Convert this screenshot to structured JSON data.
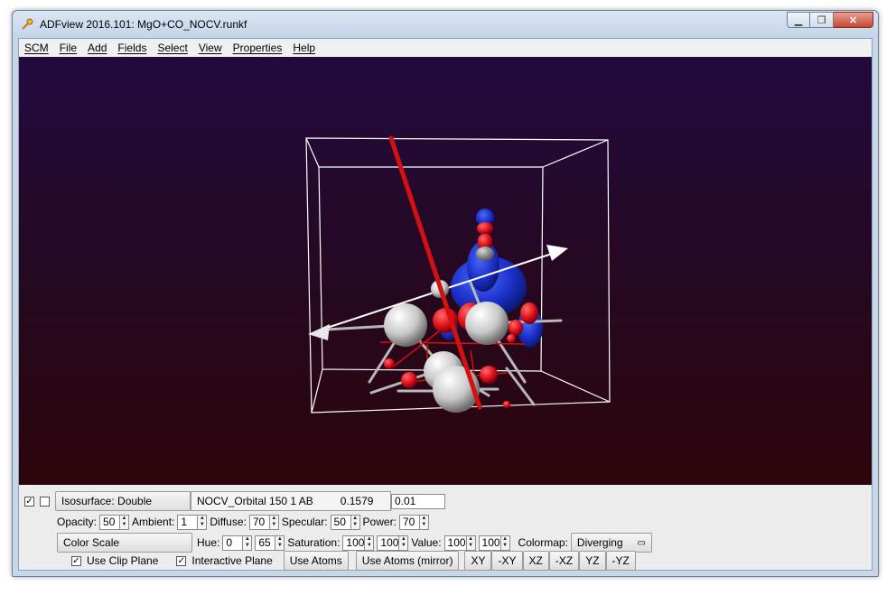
{
  "window": {
    "title": "ADFview 2016.101: MgO+CO_NOCV.runkf"
  },
  "menu": [
    "SCM",
    "File",
    "Add",
    "Fields",
    "Select",
    "View",
    "Properties",
    "Help"
  ],
  "isosurface": {
    "enabled_check": "✓",
    "type_label": "Isosurface: Double",
    "field_name": "NOCV_Orbital 150 1 AB",
    "field_value": "0.1579",
    "iso_value": "0.01"
  },
  "lighting": {
    "opacity_label": "Opacity:",
    "opacity": "50",
    "ambient_label": "Ambient:",
    "ambient": "1",
    "diffuse_label": "Diffuse:",
    "diffuse": "70",
    "specular_label": "Specular:",
    "specular": "50",
    "power_label": "Power:",
    "power": "70"
  },
  "color": {
    "scale_button": "Color Scale",
    "hue_label": "Hue:",
    "hue_min": "0",
    "hue_max": "65",
    "saturation_label": "Saturation:",
    "sat_min": "100",
    "sat_max": "100",
    "value_label": "Value:",
    "val_min": "100",
    "val_max": "100",
    "colormap_label": "Colormap:",
    "colormap": "Diverging"
  },
  "clip": {
    "use_clip_plane": "Use Clip Plane",
    "interactive_plane": "Interactive Plane",
    "use_atoms": "Use Atoms",
    "use_atoms_mirror": "Use Atoms (mirror)",
    "planes": [
      "XY",
      "-XY",
      "XZ",
      "-XZ",
      "YZ",
      "-YZ"
    ]
  },
  "colors": {
    "background_top": "#230a3f",
    "background_bottom": "#2c050c",
    "axis_red": "#d41010",
    "lobe_blue": "#1a2fc8",
    "lobe_red": "#e0101a"
  }
}
